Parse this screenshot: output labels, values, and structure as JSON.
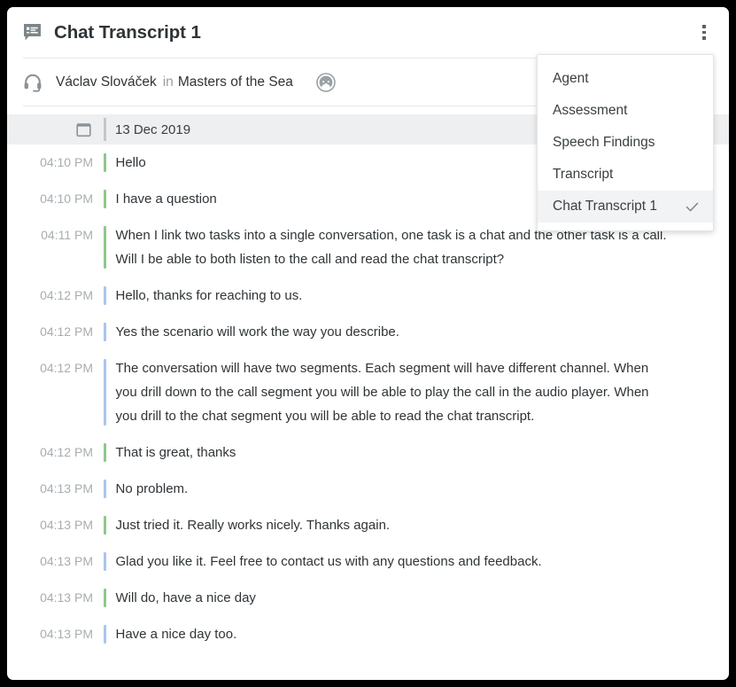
{
  "window": {
    "title": "Chat Transcript 1",
    "title_icon": "chat-transcript-icon",
    "menu_button_icon": "kebab-menu-icon"
  },
  "subheader": {
    "agent_icon": "headset-icon",
    "agent_name": "Václav Slováček",
    "separator": "in",
    "team_name": "Masters of the Sea",
    "sentiment_icon": "neutral-face-icon"
  },
  "dropdown": {
    "items": [
      {
        "label": "Agent",
        "selected": false
      },
      {
        "label": "Assessment",
        "selected": false
      },
      {
        "label": "Speech Findings",
        "selected": false
      },
      {
        "label": "Transcript",
        "selected": false
      },
      {
        "label": "Chat Transcript 1",
        "selected": true
      }
    ],
    "check_icon": "check-icon"
  },
  "transcript": {
    "date_icon": "calendar-icon",
    "date": "13 Dec 2019",
    "colors": {
      "customer_bar": "#8ec88a",
      "agent_bar": "#a8c6ef",
      "date_band": "#eeeff0",
      "timestamp": "#a7adb1",
      "message_text": "#2f3437"
    },
    "messages": [
      {
        "time": "04:10 PM",
        "speaker": "customer",
        "lines": [
          "Hello"
        ]
      },
      {
        "time": "04:10 PM",
        "speaker": "customer",
        "lines": [
          "I have a question"
        ]
      },
      {
        "time": "04:11 PM",
        "speaker": "customer",
        "lines": [
          "When I link two tasks into a single conversation, one task is a chat and the other task is a call.",
          "Will I be able to both listen to the call and read the chat transcript?"
        ]
      },
      {
        "time": "04:12 PM",
        "speaker": "agent",
        "lines": [
          "Hello, thanks for reaching to us."
        ]
      },
      {
        "time": "04:12 PM",
        "speaker": "agent",
        "lines": [
          "Yes the scenario will work the way you describe."
        ]
      },
      {
        "time": "04:12 PM",
        "speaker": "agent",
        "lines": [
          "The conversation will have two segments. Each segment will have different channel. When",
          "you drill down to the call segment you will be able to play the call in the audio player. When",
          "you drill to the chat segment you will be able to read the chat transcript."
        ]
      },
      {
        "time": "04:12 PM",
        "speaker": "customer",
        "lines": [
          "That is great, thanks"
        ]
      },
      {
        "time": "04:13 PM",
        "speaker": "agent",
        "lines": [
          "No problem."
        ]
      },
      {
        "time": "04:13 PM",
        "speaker": "customer",
        "lines": [
          "Just tried it. Really works nicely. Thanks again."
        ]
      },
      {
        "time": "04:13 PM",
        "speaker": "agent",
        "lines": [
          "Glad you like it. Feel free to contact us with any questions and feedback."
        ]
      },
      {
        "time": "04:13 PM",
        "speaker": "customer",
        "lines": [
          "Will do, have a nice day"
        ]
      },
      {
        "time": "04:13 PM",
        "speaker": "agent",
        "lines": [
          "Have a nice day too."
        ]
      }
    ]
  }
}
